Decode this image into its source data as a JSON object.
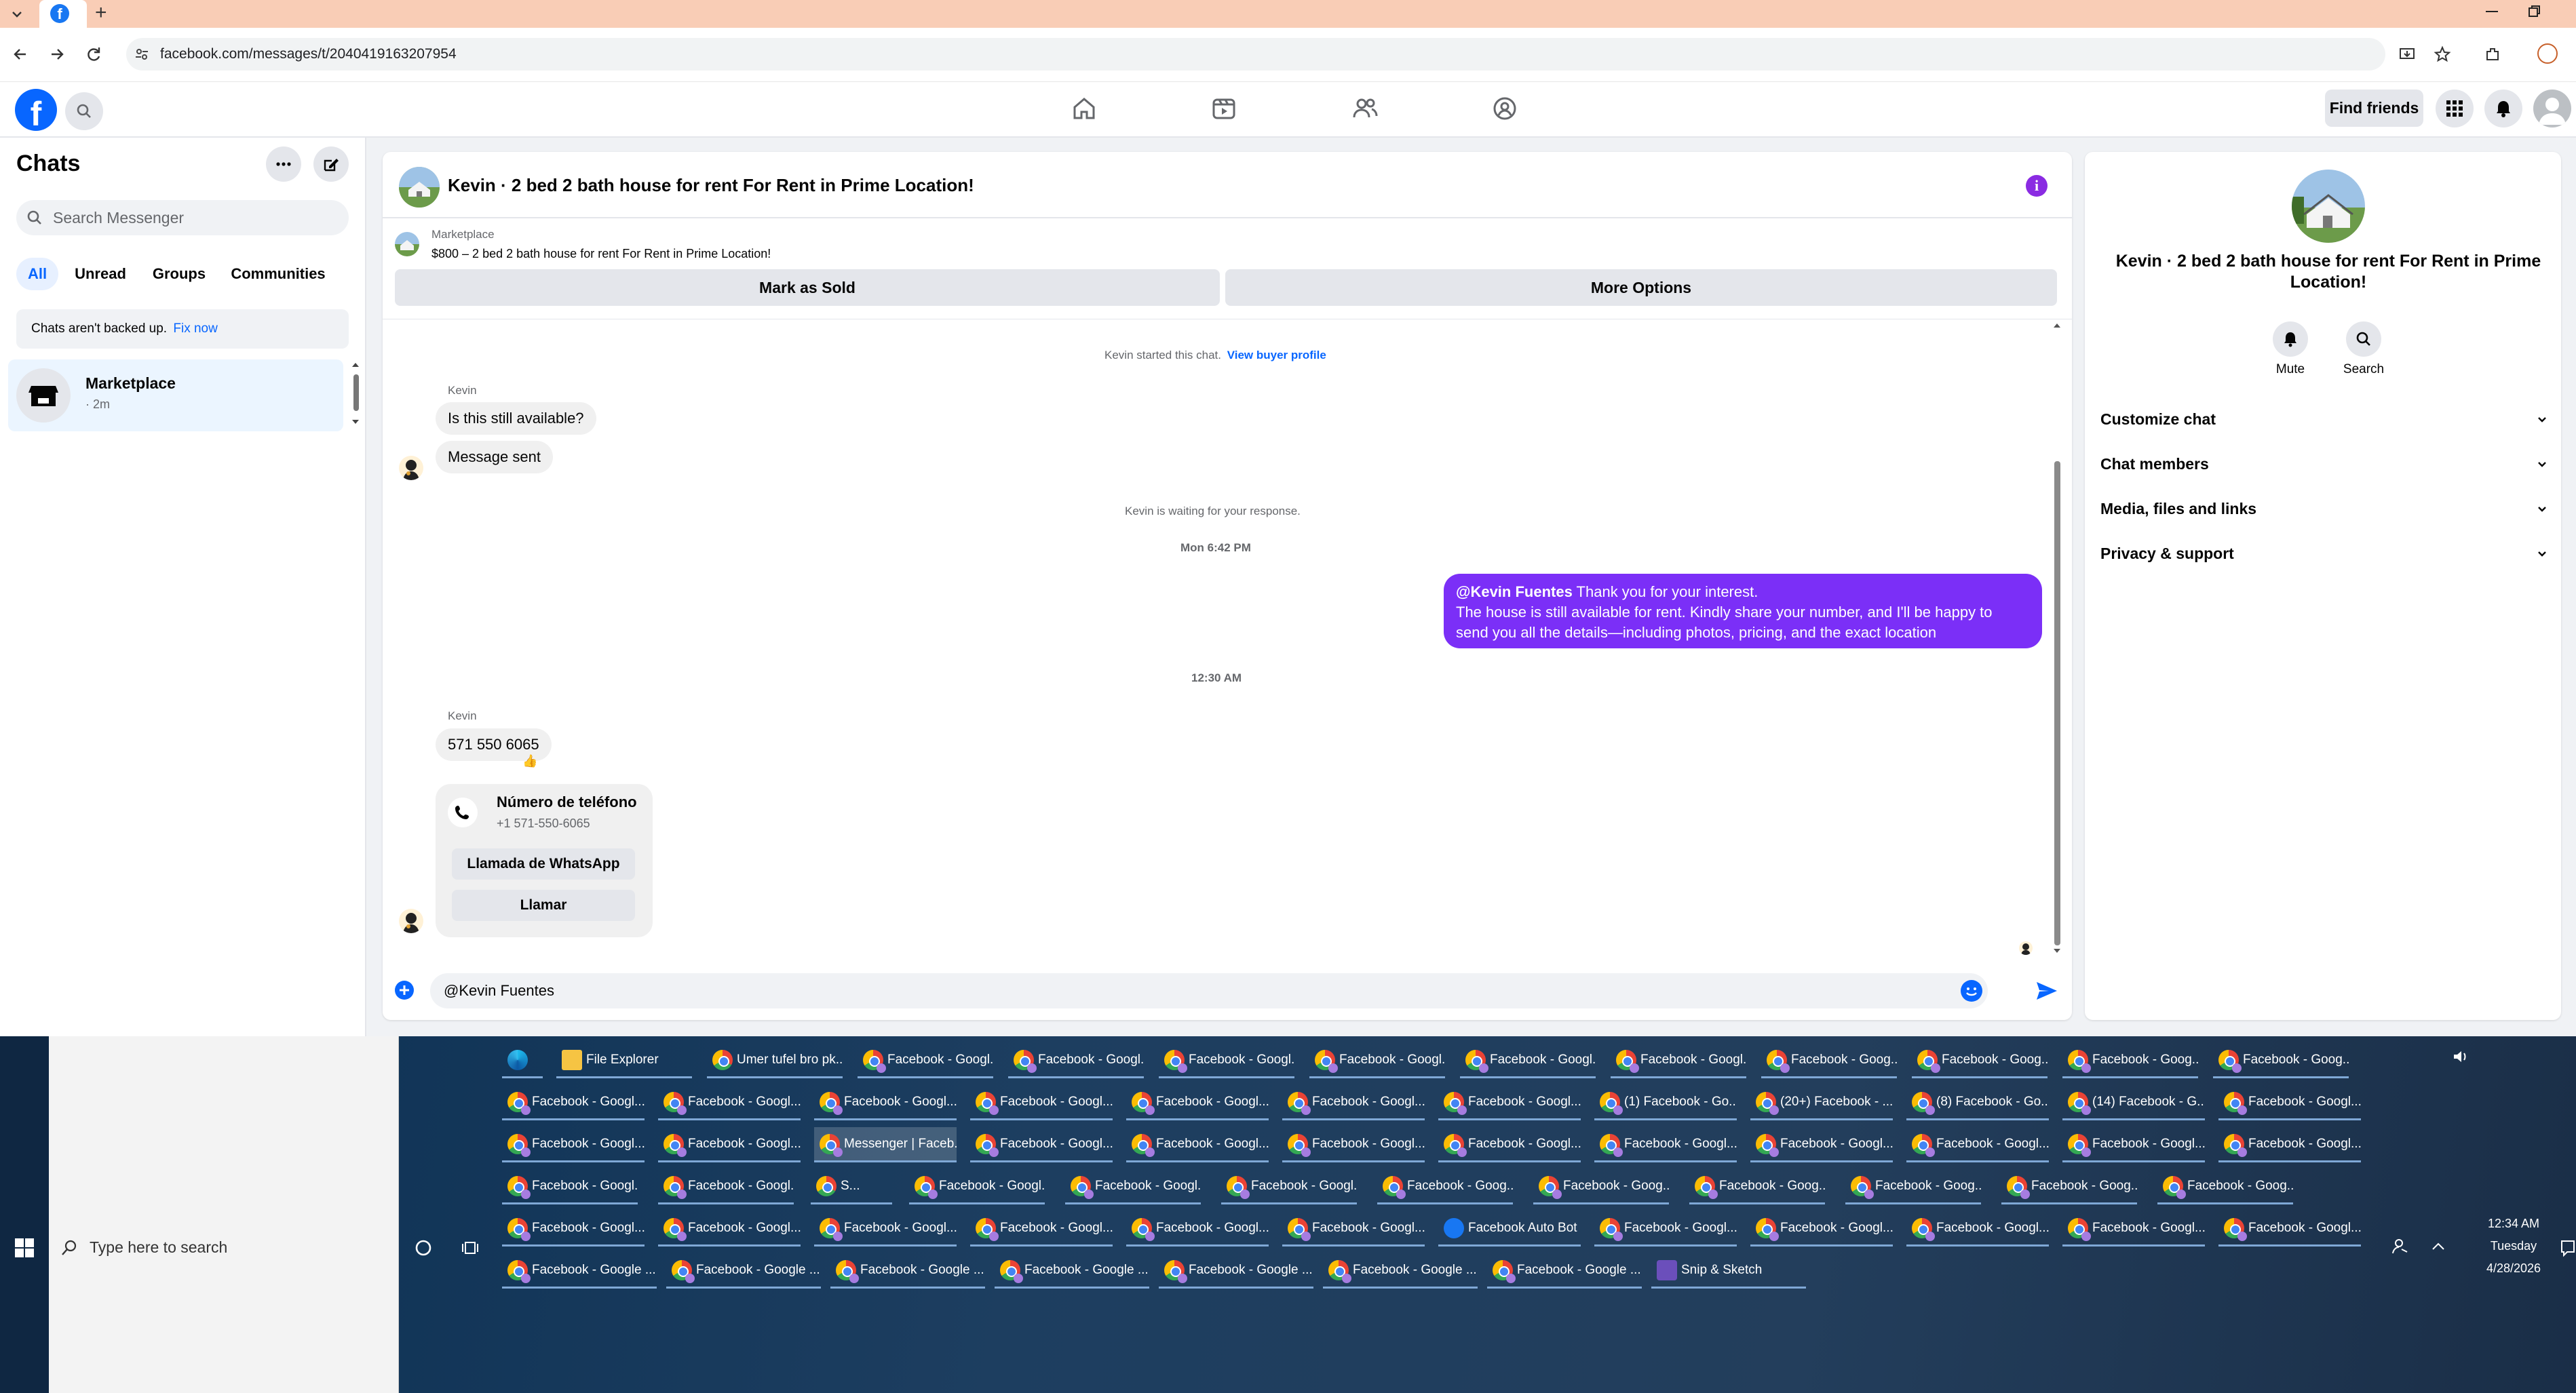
{
  "browser": {
    "url": "facebook.com/messages/t/2040419163207954",
    "new_tab_symbol": "+"
  },
  "header": {
    "find_friends": "Find friends"
  },
  "sidebar": {
    "title": "Chats",
    "search_placeholder": "Search Messenger",
    "filters": [
      "All",
      "Unread",
      "Groups",
      "Communities"
    ],
    "backup_notice": "Chats aren't backed up.",
    "backup_link": "Fix now",
    "chats": [
      {
        "name": "Marketplace",
        "time": "· 2m"
      }
    ]
  },
  "conversation": {
    "title": "Kevin · 2 bed 2 bath house for rent For Rent in Prime Location!",
    "listing_source": "Marketplace",
    "listing_text": "$800 – 2 bed 2 bath house for rent For Rent in Prime Location!",
    "mark_sold": "Mark as Sold",
    "more_options": "More Options",
    "started_text": "Kevin started this chat.",
    "view_profile": "View buyer profile",
    "sender1": "Kevin",
    "msg1": "Is this still available?",
    "msg2": "Message sent",
    "waiting": "Kevin is waiting for your response.",
    "time1": "Mon 6:42 PM",
    "my_mention": "@Kevin Fuentes",
    "my_line1": " Thank you for your interest.",
    "my_line2": "The house is still available for rent. Kindly share your number, and I'll be happy to",
    "my_line3": "send you all the details—including photos, pricing, and the exact location",
    "time2": "12:30 AM",
    "sender2": "Kevin",
    "phone_msg": "571 550 6065",
    "reaction": "👍",
    "card_title": "Número de teléfono",
    "card_phone": "+1 571-550-6065",
    "card_btn1": "Llamada de WhatsApp",
    "card_btn2": "Llamar",
    "input_value": "@Kevin Fuentes"
  },
  "info_panel": {
    "title": "Kevin · 2 bed 2 bath house for rent For Rent in Prime Location!",
    "mute": "Mute",
    "search": "Search",
    "sections": [
      "Customize chat",
      "Chat members",
      "Media, files and links",
      "Privacy & support"
    ]
  },
  "taskbar": {
    "search_placeholder": "Type here to search",
    "clock_time": "12:34 AM",
    "clock_day": "Tuesday",
    "clock_date": "4/28/2026",
    "row1": [
      "",
      "File Explorer",
      "Umer tufel bro pk...",
      "Facebook - Googl...",
      "Facebook - Googl...",
      "Facebook - Googl...",
      "Facebook - Googl...",
      "Facebook - Googl...",
      "Facebook - Googl...",
      "Facebook - Goog...",
      "Facebook - Goog...",
      "Facebook - Goog...",
      "Facebook - Goog..."
    ],
    "row2": [
      "Facebook - Googl...",
      "Facebook - Googl...",
      "Facebook - Googl...",
      "Facebook - Googl...",
      "Facebook - Googl...",
      "Facebook - Googl...",
      "Facebook - Googl...",
      "(1) Facebook - Go...",
      "(20+) Facebook - ...",
      "(8) Facebook - Go...",
      "(14) Facebook - G...",
      "Facebook - Googl..."
    ],
    "row3": [
      "Facebook - Googl...",
      "Facebook - Googl...",
      "Messenger | Faceb...",
      "Facebook - Googl...",
      "Facebook - Googl...",
      "Facebook - Googl...",
      "Facebook - Googl...",
      "Facebook - Googl...",
      "Facebook - Googl...",
      "Facebook - Googl...",
      "Facebook - Googl...",
      "Facebook - Googl..."
    ],
    "row4": [
      "Facebook - Googl...",
      "Facebook - Googl...",
      "S...",
      "Facebook - Googl...",
      "Facebook - Googl...",
      "Facebook - Googl...",
      "Facebook - Goog...",
      "Facebook - Goog...",
      "Facebook - Goog...",
      "Facebook - Goog...",
      "Facebook - Goog...",
      "Facebook - Goog...",
      "Facebook - Goog..."
    ],
    "row5": [
      "Facebook - Googl...",
      "Facebook - Googl...",
      "Facebook - Googl...",
      "Facebook - Googl...",
      "Facebook - Googl...",
      "Facebook - Googl...",
      "Facebook Auto Bot",
      "Facebook - Googl...",
      "Facebook - Googl...",
      "Facebook - Googl...",
      "Facebook - Googl...",
      "Facebook - Googl..."
    ],
    "row6": [
      "Facebook - Google ...",
      "Facebook - Google ...",
      "Facebook - Google ...",
      "Facebook - Google ...",
      "Facebook - Google ...",
      "Facebook - Google ...",
      "Facebook - Google ...",
      "Snip & Sketch"
    ]
  },
  "colors": {
    "brand": "#0866ff",
    "my_bubble": "#7b2ff7",
    "tab_strip": "#f9cdb6"
  }
}
